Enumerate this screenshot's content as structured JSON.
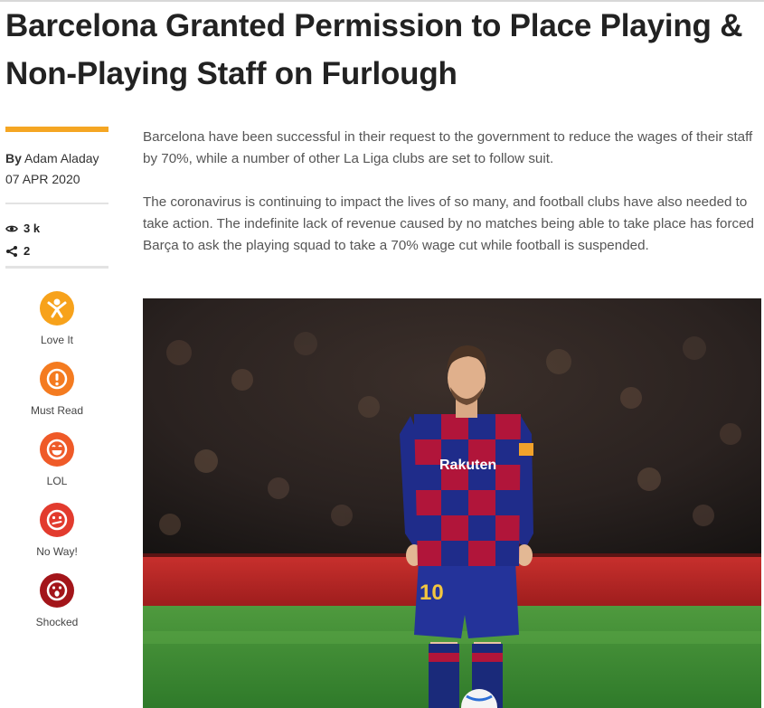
{
  "article": {
    "title": "Barcelona Granted Permission to Place Playing & Non-Playing Staff on Furlough",
    "byline_prefix": "By",
    "author": "Adam Aladay",
    "date": "07 APR 2020",
    "views": "3 k",
    "shares": "2",
    "paragraphs": [
      "Barcelona have been successful in their request to the government to reduce the wages of their staff by 70%, while a number of other La Liga clubs are set to follow suit.",
      "The coronavirus is continuing to impact the lives of so many, and football clubs have also needed to take action. The indefinite lack of revenue caused by no matches being able to take place has forced Barça to ask the playing squad to take a 70% wage cut while football is suspended."
    ],
    "photo": {
      "shirt_sponsor": "Rakuten",
      "shirt_number": "10"
    }
  },
  "reactions": [
    {
      "label": "Love It",
      "icon": "love-it-icon",
      "color": "#f7a21b"
    },
    {
      "label": "Must Read",
      "icon": "must-read-icon",
      "color": "#f47b20"
    },
    {
      "label": "LOL",
      "icon": "lol-icon",
      "color": "#ef5a28"
    },
    {
      "label": "No Way!",
      "icon": "no-way-icon",
      "color": "#e23b2e"
    },
    {
      "label": "Shocked",
      "icon": "shocked-icon",
      "color": "#a3151a"
    }
  ],
  "colors": {
    "accent": "#f5a623"
  }
}
